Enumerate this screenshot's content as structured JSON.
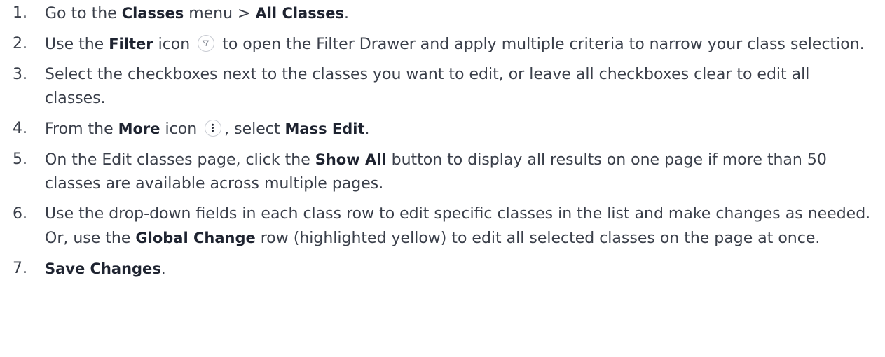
{
  "steps": [
    {
      "num": "1.",
      "parts": [
        "Go to the ",
        "Classes",
        " menu > ",
        "All Classes",
        "."
      ]
    },
    {
      "num": "2.",
      "parts": [
        "Use the ",
        "Filter",
        " icon",
        " to open the Filter Drawer and apply multiple criteria to narrow your class selection."
      ],
      "icon": "filter-icon"
    },
    {
      "num": "3.",
      "text": "Select the checkboxes next to the classes you want to edit, or leave all checkboxes clear to edit all classes."
    },
    {
      "num": "4.",
      "parts": [
        "From the ",
        "More",
        " icon",
        ", select ",
        "Mass Edit",
        "."
      ],
      "icon": "more-vertical-icon"
    },
    {
      "num": "5.",
      "parts": [
        "On the Edit classes page, click the ",
        "Show All",
        " button to display all results on one page if more than 50 classes are available across multiple pages."
      ]
    },
    {
      "num": "6.",
      "parts": [
        "Use the drop-down fields in each class row to edit specific classes in the list and make changes as needed. Or, use the ",
        "Global Change",
        " row (highlighted yellow) to edit all selected classes on the page at once."
      ]
    },
    {
      "num": "7.",
      "parts": [
        "Save Changes",
        "."
      ]
    }
  ]
}
